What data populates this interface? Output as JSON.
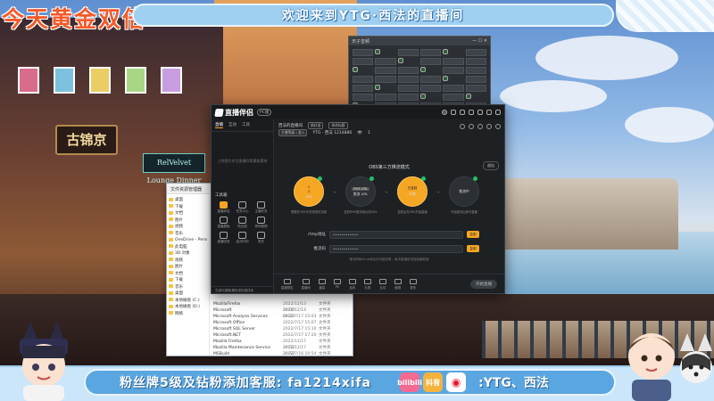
{
  "overlay": {
    "top_left_text": "今天黄金双倍",
    "top_banner_text": "欢迎来到YTG·西法的直播间",
    "bottom_text": "粉丝牌5级及钻粉添加客服: fa1214xifa",
    "bottom_right_text": ":YTG、西法",
    "bottom_icons": [
      "bilibili-icon",
      "douyin-icon",
      "weibo-icon"
    ],
    "bottom_icon_labels": [
      "bilibili",
      "抖音"
    ],
    "shop_sign": "古锦京",
    "neon_sign": "RelVelvet Lounge Dinner",
    "colors": {
      "accent": "#f5a623",
      "banner": "#9fd0f2",
      "bottom_pill": "#5aa6e0",
      "headline": "#f45a2a"
    }
  },
  "app": {
    "logo_text": "直播伴侣",
    "version": "PC版",
    "left_tabs": [
      "直播",
      "互动",
      "工具"
    ],
    "left_empty_text": "上传图片作为直播间背景和素材",
    "tools_title": "工具箱",
    "tools": [
      {
        "label": "直播伴侣",
        "icon": "live-icon",
        "orange": true
      },
      {
        "label": "任务中心",
        "icon": "task-icon",
        "orange": false
      },
      {
        "label": "主播任务",
        "icon": "anchor-icon",
        "orange": false
      },
      {
        "label": "直播看板",
        "icon": "dashboard-icon",
        "orange": false
      },
      {
        "label": "粉丝团",
        "icon": "fans-icon",
        "orange": false
      },
      {
        "label": "房间管理",
        "icon": "room-icon",
        "orange": false
      },
      {
        "label": "直播回放",
        "icon": "replay-icon",
        "orange": false
      },
      {
        "label": "高光时刻",
        "icon": "highlight-icon",
        "orange": false
      },
      {
        "label": "更多",
        "icon": "more-icon",
        "orange": false
      }
    ],
    "left_footer": "右键可编辑/删除或拖拽排序",
    "room_title": "西法的直播间",
    "room_chip_1": "换封面",
    "room_chip_2": "修改标题",
    "room_line2_chip": "主播等级 | 准入",
    "room_id": "YTG · 西法 1214886",
    "room_viewers": "1",
    "obs_title": "OBS第三方推流模式",
    "obs_exit": "退出",
    "steps": [
      {
        "title": "OBS",
        "pills": [
          "1",
          "2"
        ],
        "on": true,
        "desc": "需要在OBS中完成相关设置"
      },
      {
        "title": "推流 URL",
        "pills": [
          "RMS URL"
        ],
        "on": false,
        "desc": "复制RMS推流地址到OBS"
      },
      {
        "title": "开播",
        "pills": [
          "已复制"
        ],
        "on": true,
        "desc": "复制后在OBS开始直播"
      },
      {
        "title": "推流中",
        "pills": [],
        "on": false,
        "desc": "开始推流后即可直播"
      }
    ],
    "step_arrows": [
      "→",
      "→",
      "→"
    ],
    "fields": [
      {
        "label": "rtmp地址",
        "value": "••••••••••••",
        "button": "复制"
      },
      {
        "label": "推流码",
        "value": "••••••••••••",
        "button": "复制"
      }
    ],
    "field_note": "推流码和rtmp地址均可能变更，每次直播前请复制最新值",
    "bottom_tools": [
      "直播预告",
      "直播间",
      "福袋",
      "PK",
      "连线",
      "礼物",
      "互动",
      "截屏",
      "更多"
    ],
    "start_button": "开始直播"
  },
  "explorer": {
    "title": "文件资源管理器",
    "side_items": [
      "桌面",
      "下载",
      "文档",
      "图片",
      "视频",
      "音乐",
      "OneDrive - Personal",
      "此电脑",
      "3D 对象",
      "视频",
      "图片",
      "文档",
      "下载",
      "音乐",
      "桌面",
      "本地磁盘 (C:)",
      "本地磁盘 (D:)",
      "网络"
    ],
    "rows": [
      {
        "name": "MozillaFirefox",
        "date": "2022/12/13 16:09",
        "type": "文件夹"
      },
      {
        "name": "Microsoft",
        "date": "2022/12/14 09:22",
        "type": "文件夹"
      },
      {
        "name": "Microsoft Analysis Services",
        "date": "2022/7/17 15:03",
        "type": "文件夹"
      },
      {
        "name": "Microsoft Office",
        "date": "2022/7/17 15:07",
        "type": "文件夹"
      },
      {
        "name": "Microsoft SQL Server",
        "date": "2022/7/17 15:10",
        "type": "文件夹"
      },
      {
        "name": "Microsoft.NET",
        "date": "2022/7/17 17:20",
        "type": "文件夹"
      },
      {
        "name": "Mozilla Firefox",
        "date": "2022/12/17 20:52",
        "type": "文件夹"
      },
      {
        "name": "Mozilla Maintenance Service",
        "date": "2022/12/17 20:52",
        "type": "文件夹"
      },
      {
        "name": "MSBuild",
        "date": "2022/7/16 10:54",
        "type": "文件夹"
      }
    ]
  },
  "dark_window": {
    "title": "天子音频",
    "label": "天子音频"
  }
}
